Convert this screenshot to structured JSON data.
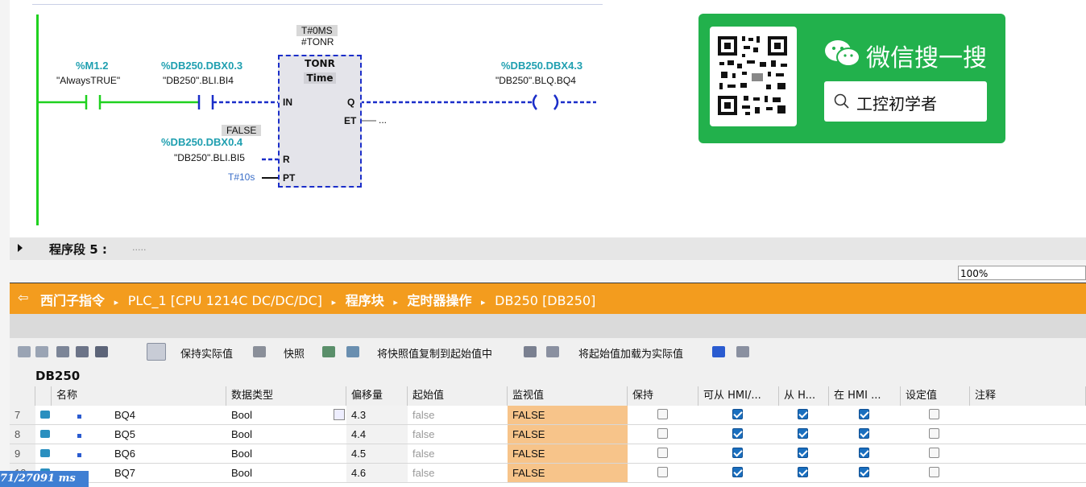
{
  "ladder": {
    "contact1": {
      "address": "%M1.2",
      "symbol": "\"AlwaysTRUE\""
    },
    "contact2": {
      "address": "%DB250.DBX0.3",
      "symbol": "\"DB250\".BLI.BI4"
    },
    "timer": {
      "preset_tag": "T#0MS",
      "instance": "#TONR",
      "type": "TONR",
      "sub": "Time",
      "pin_in": "IN",
      "pin_q": "Q",
      "pin_et": "ET",
      "pin_r": "R",
      "pin_pt": "PT",
      "et_value": "...",
      "pt_value": "T#10s"
    },
    "reset": {
      "state": "FALSE",
      "address": "%DB250.DBX0.4",
      "symbol": "\"DB250\".BLI.BI5"
    },
    "coil": {
      "address": "%DB250.DBX4.3",
      "symbol": "\"DB250\".BLQ.BQ4"
    }
  },
  "segment": {
    "label": "程序段 5 :",
    "comment": "....."
  },
  "zoom": "100%",
  "breadcrumb": {
    "items": [
      "西门子指令",
      "PLC_1 [CPU 1214C DC/DC/DC]",
      "程序块",
      "定时器操作",
      "DB250 [DB250]"
    ],
    "separator": "▸"
  },
  "toolbar": {
    "keep_actual": "保持实际值",
    "snapshot": "快照",
    "copy_snapshot": "将快照值复制到起始值中",
    "load_start": "将起始值加载为实际值"
  },
  "db_title": "DB250",
  "table": {
    "headers": [
      "名称",
      "数据类型",
      "偏移量",
      "起始值",
      "监视值",
      "保持",
      "可从 HMI/...",
      "从 H...",
      "在 HMI ...",
      "设定值",
      "注释"
    ],
    "rows": [
      {
        "num": "7",
        "name": "BQ4",
        "type": "Bool",
        "offset": "4.3",
        "start": "false",
        "monitor": "FALSE",
        "retain": false,
        "hmi_access": true,
        "hmi_visible": true,
        "hmi_in": true,
        "setpoint": false
      },
      {
        "num": "8",
        "name": "BQ5",
        "type": "Bool",
        "offset": "4.4",
        "start": "false",
        "monitor": "FALSE",
        "retain": false,
        "hmi_access": true,
        "hmi_visible": true,
        "hmi_in": true,
        "setpoint": false
      },
      {
        "num": "9",
        "name": "BQ6",
        "type": "Bool",
        "offset": "4.5",
        "start": "false",
        "monitor": "FALSE",
        "retain": false,
        "hmi_access": true,
        "hmi_visible": true,
        "hmi_in": true,
        "setpoint": false
      },
      {
        "num": "10",
        "name": "BQ7",
        "type": "Bool",
        "offset": "4.6",
        "start": "false",
        "monitor": "FALSE",
        "retain": false,
        "hmi_access": true,
        "hmi_visible": true,
        "hmi_in": true,
        "setpoint": false
      }
    ]
  },
  "wechat": {
    "title": "微信搜一搜",
    "search": "工控初学者"
  },
  "timer_overlay": "71/27091 ms",
  "colors": {
    "accent_orange": "#f39c1e",
    "wechat_green": "#22b14c",
    "ladder_green": "#1fd11f",
    "dashed_blue": "#1b2ec9",
    "monitor_fill": "#f7c48a"
  }
}
